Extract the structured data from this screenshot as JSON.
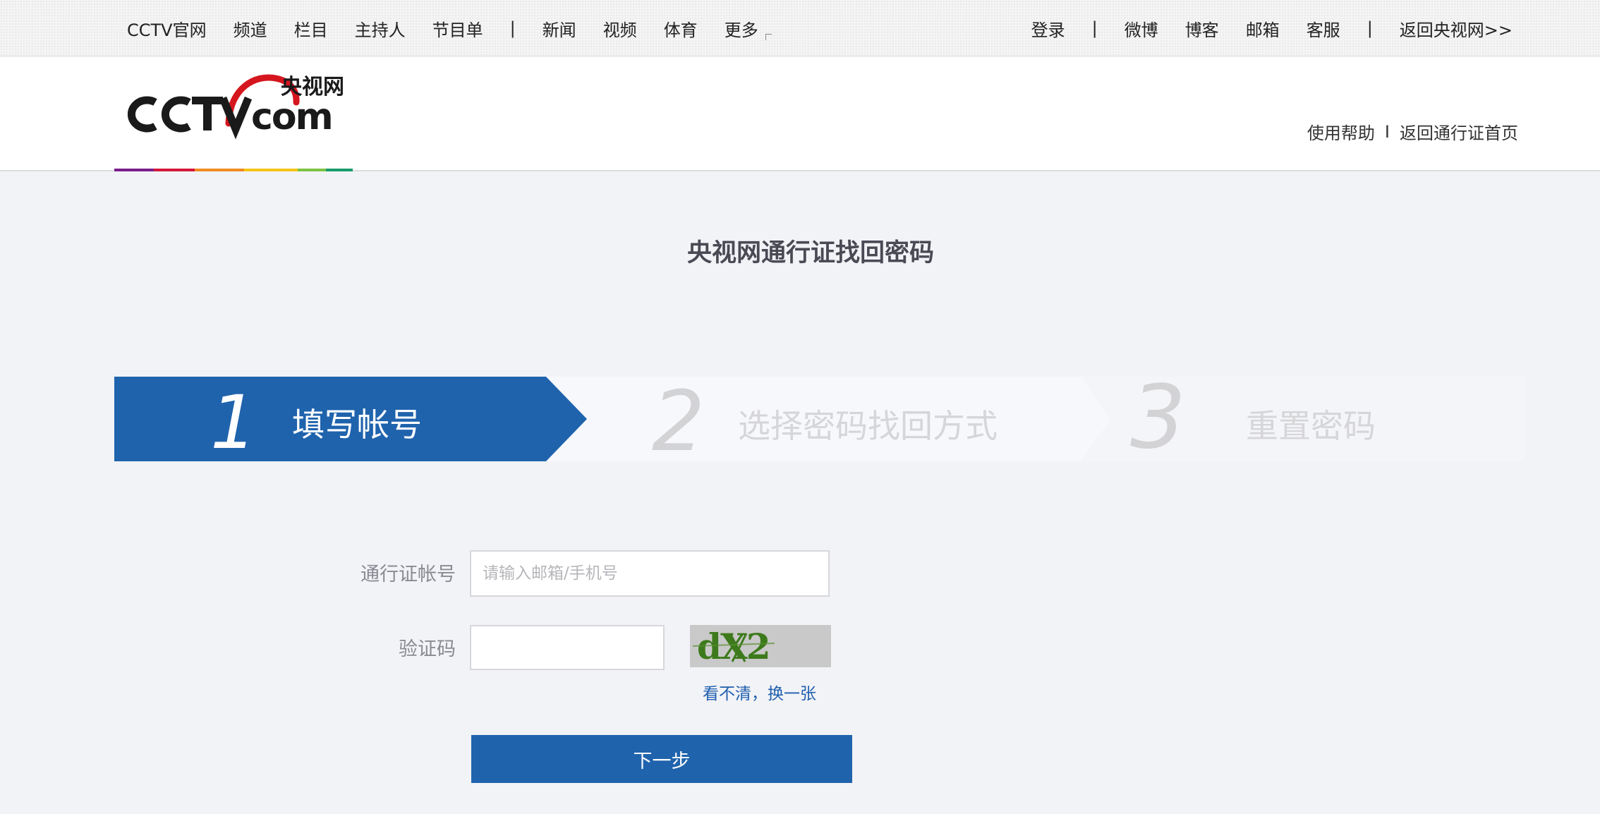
{
  "topnav": {
    "left": [
      "CCTV官网",
      "频道",
      "栏目",
      "主持人",
      "节目单"
    ],
    "left2": [
      "新闻",
      "视频",
      "体育",
      "更多"
    ],
    "right_login": "登录",
    "right_links": [
      "微博",
      "博客",
      "邮箱",
      "客服"
    ],
    "right_return": "返回央视网>>",
    "separator": "|"
  },
  "logo": {
    "text_cn": "央视网",
    "text_cctv": "CCTV",
    "text_com": "com",
    "stripe_colors": [
      "#7a1f8c",
      "#d4173a",
      "#f08a24",
      "#f5c518",
      "#7cc243",
      "#1a9b6c"
    ]
  },
  "header_links": {
    "help": "使用帮助",
    "separator": "I",
    "home": "返回通行证首页"
  },
  "title": "央视网通行证找回密码",
  "steps": [
    {
      "number": "1",
      "label": "填写帐号",
      "active": true
    },
    {
      "number": "2",
      "label": "选择密码找回方式",
      "active": false
    },
    {
      "number": "3",
      "label": "重置密码",
      "active": false
    }
  ],
  "form": {
    "account_label": "通行证帐号",
    "account_placeholder": "请输入邮箱/手机号",
    "account_value": "",
    "captcha_label": "验证码",
    "captcha_value": "",
    "captcha_text": "dX2",
    "refresh_text": "看不清，换一张",
    "next_button": "下一步"
  },
  "colors": {
    "primary_blue": "#1f63ad",
    "page_bg": "#f2f3f7",
    "captcha_green": "#3d7a1c"
  }
}
